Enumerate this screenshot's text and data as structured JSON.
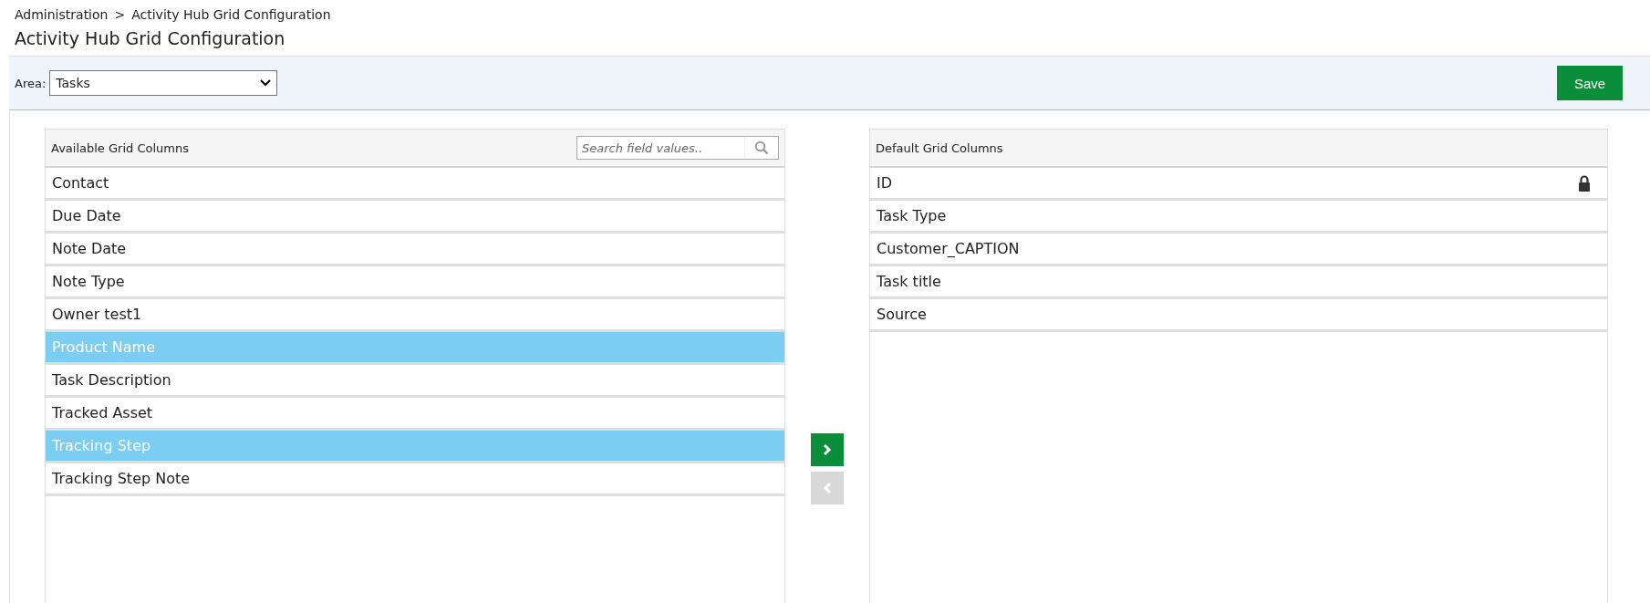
{
  "breadcrumb": [
    "Administration",
    "Activity Hub Grid Configuration"
  ],
  "breadcrumb_separator": ">",
  "title": "Activity Hub Grid Configuration",
  "toolbar": {
    "area_label": "Area:",
    "area_value": "Tasks",
    "save_button": "Save"
  },
  "available": {
    "heading": "Available Grid Columns",
    "search": {
      "placeholder": "Search field values.."
    },
    "items": [
      {
        "label": "Contact",
        "selected": false
      },
      {
        "label": "Due Date",
        "selected": false
      },
      {
        "label": "Note Date",
        "selected": false
      },
      {
        "label": "Note Type",
        "selected": false
      },
      {
        "label": "Owner test1",
        "selected": false
      },
      {
        "label": "Product Name",
        "selected": true
      },
      {
        "label": "Task Description",
        "selected": false
      },
      {
        "label": "Tracked Asset",
        "selected": false
      },
      {
        "label": "Tracking Step",
        "selected": true
      },
      {
        "label": "Tracking Step Note",
        "selected": false
      }
    ]
  },
  "move_buttons": [
    {
      "kind": "add",
      "disabled": false
    },
    {
      "kind": "remove",
      "disabled": true
    }
  ],
  "default": {
    "heading": "Default Grid Columns",
    "items": [
      {
        "label": "ID",
        "locked": true
      },
      {
        "label": "Task Type",
        "locked": false
      },
      {
        "label": "Customer_CAPTION",
        "locked": false
      },
      {
        "label": "Task title",
        "locked": false
      },
      {
        "label": "Source",
        "locked": false
      }
    ]
  }
}
